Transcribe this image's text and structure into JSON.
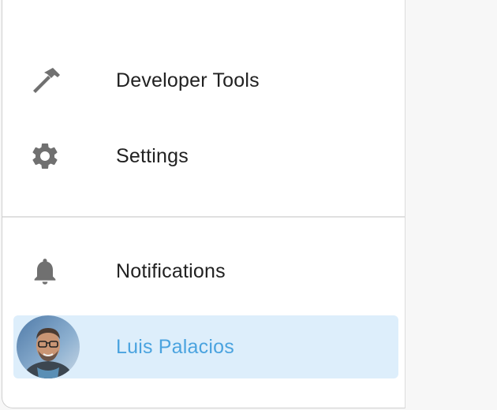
{
  "sidebar": {
    "items": [
      {
        "label": "Developer Tools",
        "icon": "hammer-icon"
      },
      {
        "label": "Settings",
        "icon": "gear-icon"
      },
      {
        "label": "Notifications",
        "icon": "bell-icon"
      },
      {
        "label": "Luis Palacios",
        "icon": "avatar"
      }
    ],
    "colors": {
      "icon": "#707070",
      "text": "#212121",
      "active_bg": "#ddeefb",
      "active_text": "#4aa3df"
    }
  }
}
